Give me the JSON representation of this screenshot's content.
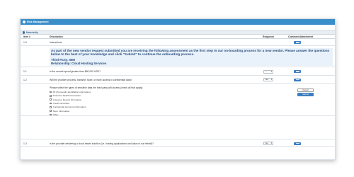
{
  "window": {
    "title": "Risk Management"
  },
  "section": {
    "title": "Materiality"
  },
  "columns": {
    "item": "Item #",
    "description": "Description",
    "response": "Response",
    "comment": "Comment/Attachment"
  },
  "rows": [
    {
      "item": "1.0",
      "description": "Instructions"
    },
    {
      "item": "1.1",
      "description": "Is the annual spend greater than $50,000 USD?",
      "response": "- -"
    },
    {
      "item": "1.2",
      "description": "Will the provider process, transmit, store, or have access to confidential data?",
      "response": "Yes"
    },
    {
      "item": "1.3",
      "description": "Is the provider delivering a cloud based solution (i.e. hosting applications and data on our behalf)?",
      "response": "Yes"
    }
  ],
  "instructions": {
    "text": "As part of the new vendor request submitted you are receiving the following assessment as the first step in our on-boarding process for a new vendor.  Please answer the questions below to the best of your knowledge and click \"Submit\" to continue the onboarding process.",
    "third_party": "Third Party: IBM",
    "relationship": "Relationship: Cloud Hosting Services"
  },
  "sensitive": {
    "prompt": "Please select the types of sensitive data the third party will access (check all that apply):",
    "options": [
      "PII (Personally Identifiable Information)",
      "Protected Health Information",
      "Customer Record Information",
      "Credit Card Data",
      "Confidential personnel information",
      "Store Information",
      "Other"
    ],
    "cancel_label": "Cancel",
    "submit_label": "Submit"
  },
  "colors": {
    "titlebar": "#3a8ec9",
    "button": "#3d7ec0",
    "instructions_bg": "#e9f2fb"
  }
}
